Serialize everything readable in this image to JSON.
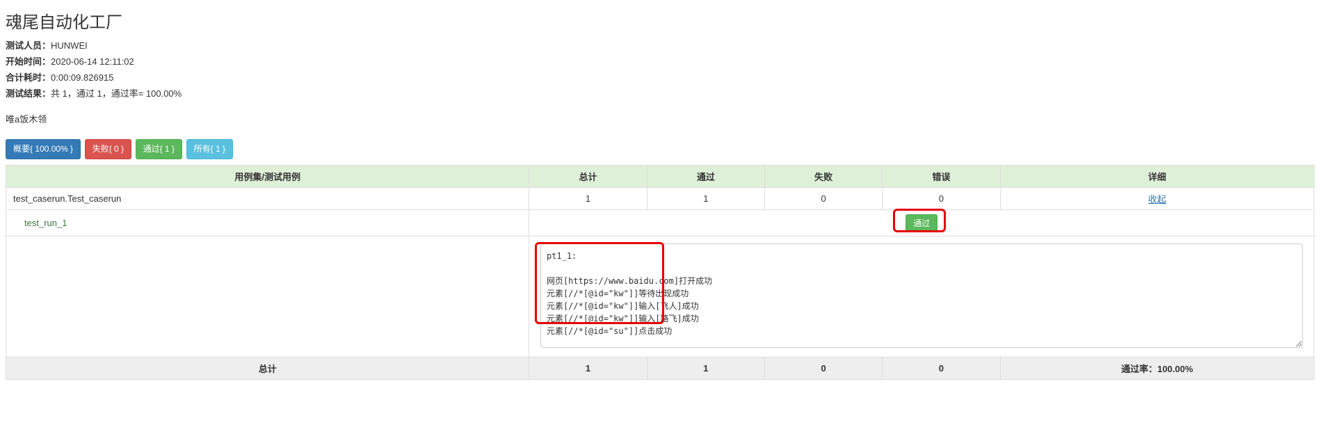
{
  "header": {
    "title": "魂尾自动化工厂",
    "tester_label": "测试人员：",
    "tester_value": "HUNWEI",
    "start_label": "开始时间：",
    "start_value": "2020-06-14 12:11:02",
    "duration_label": "合计耗时：",
    "duration_value": "0:00:09.826915",
    "result_label": "测试结果：",
    "result_value": "共 1，通过 1，通过率= 100.00%",
    "description": "唯a饭木领"
  },
  "filters": {
    "summary": "概要{ 100.00% }",
    "fail": "失败{ 0 }",
    "pass": "通过{ 1 }",
    "all": "所有{ 1 }"
  },
  "columns": {
    "case": "用例集/测试用例",
    "total": "总计",
    "pass": "通过",
    "fail": "失败",
    "error": "错误",
    "detail": "详细"
  },
  "suite": {
    "name": "test_caserun.Test_caserun",
    "total": "1",
    "pass": "1",
    "fail": "0",
    "error": "0",
    "detail_link": "收起"
  },
  "case": {
    "name": "test_run_1",
    "status": "通过",
    "log": "pt1_1:\n\n网页[https://www.baidu.com]打开成功\n元素[//*[@id=\"kw\"]]等待出现成功\n元素[//*[@id=\"kw\"]]输入[飞人]成功\n元素[//*[@id=\"kw\"]]输入[路飞]成功\n元素[//*[@id=\"su\"]]点击成功"
  },
  "footer": {
    "label": "总计",
    "total": "1",
    "pass": "1",
    "fail": "0",
    "error": "0",
    "rate": "通过率：100.00%"
  }
}
